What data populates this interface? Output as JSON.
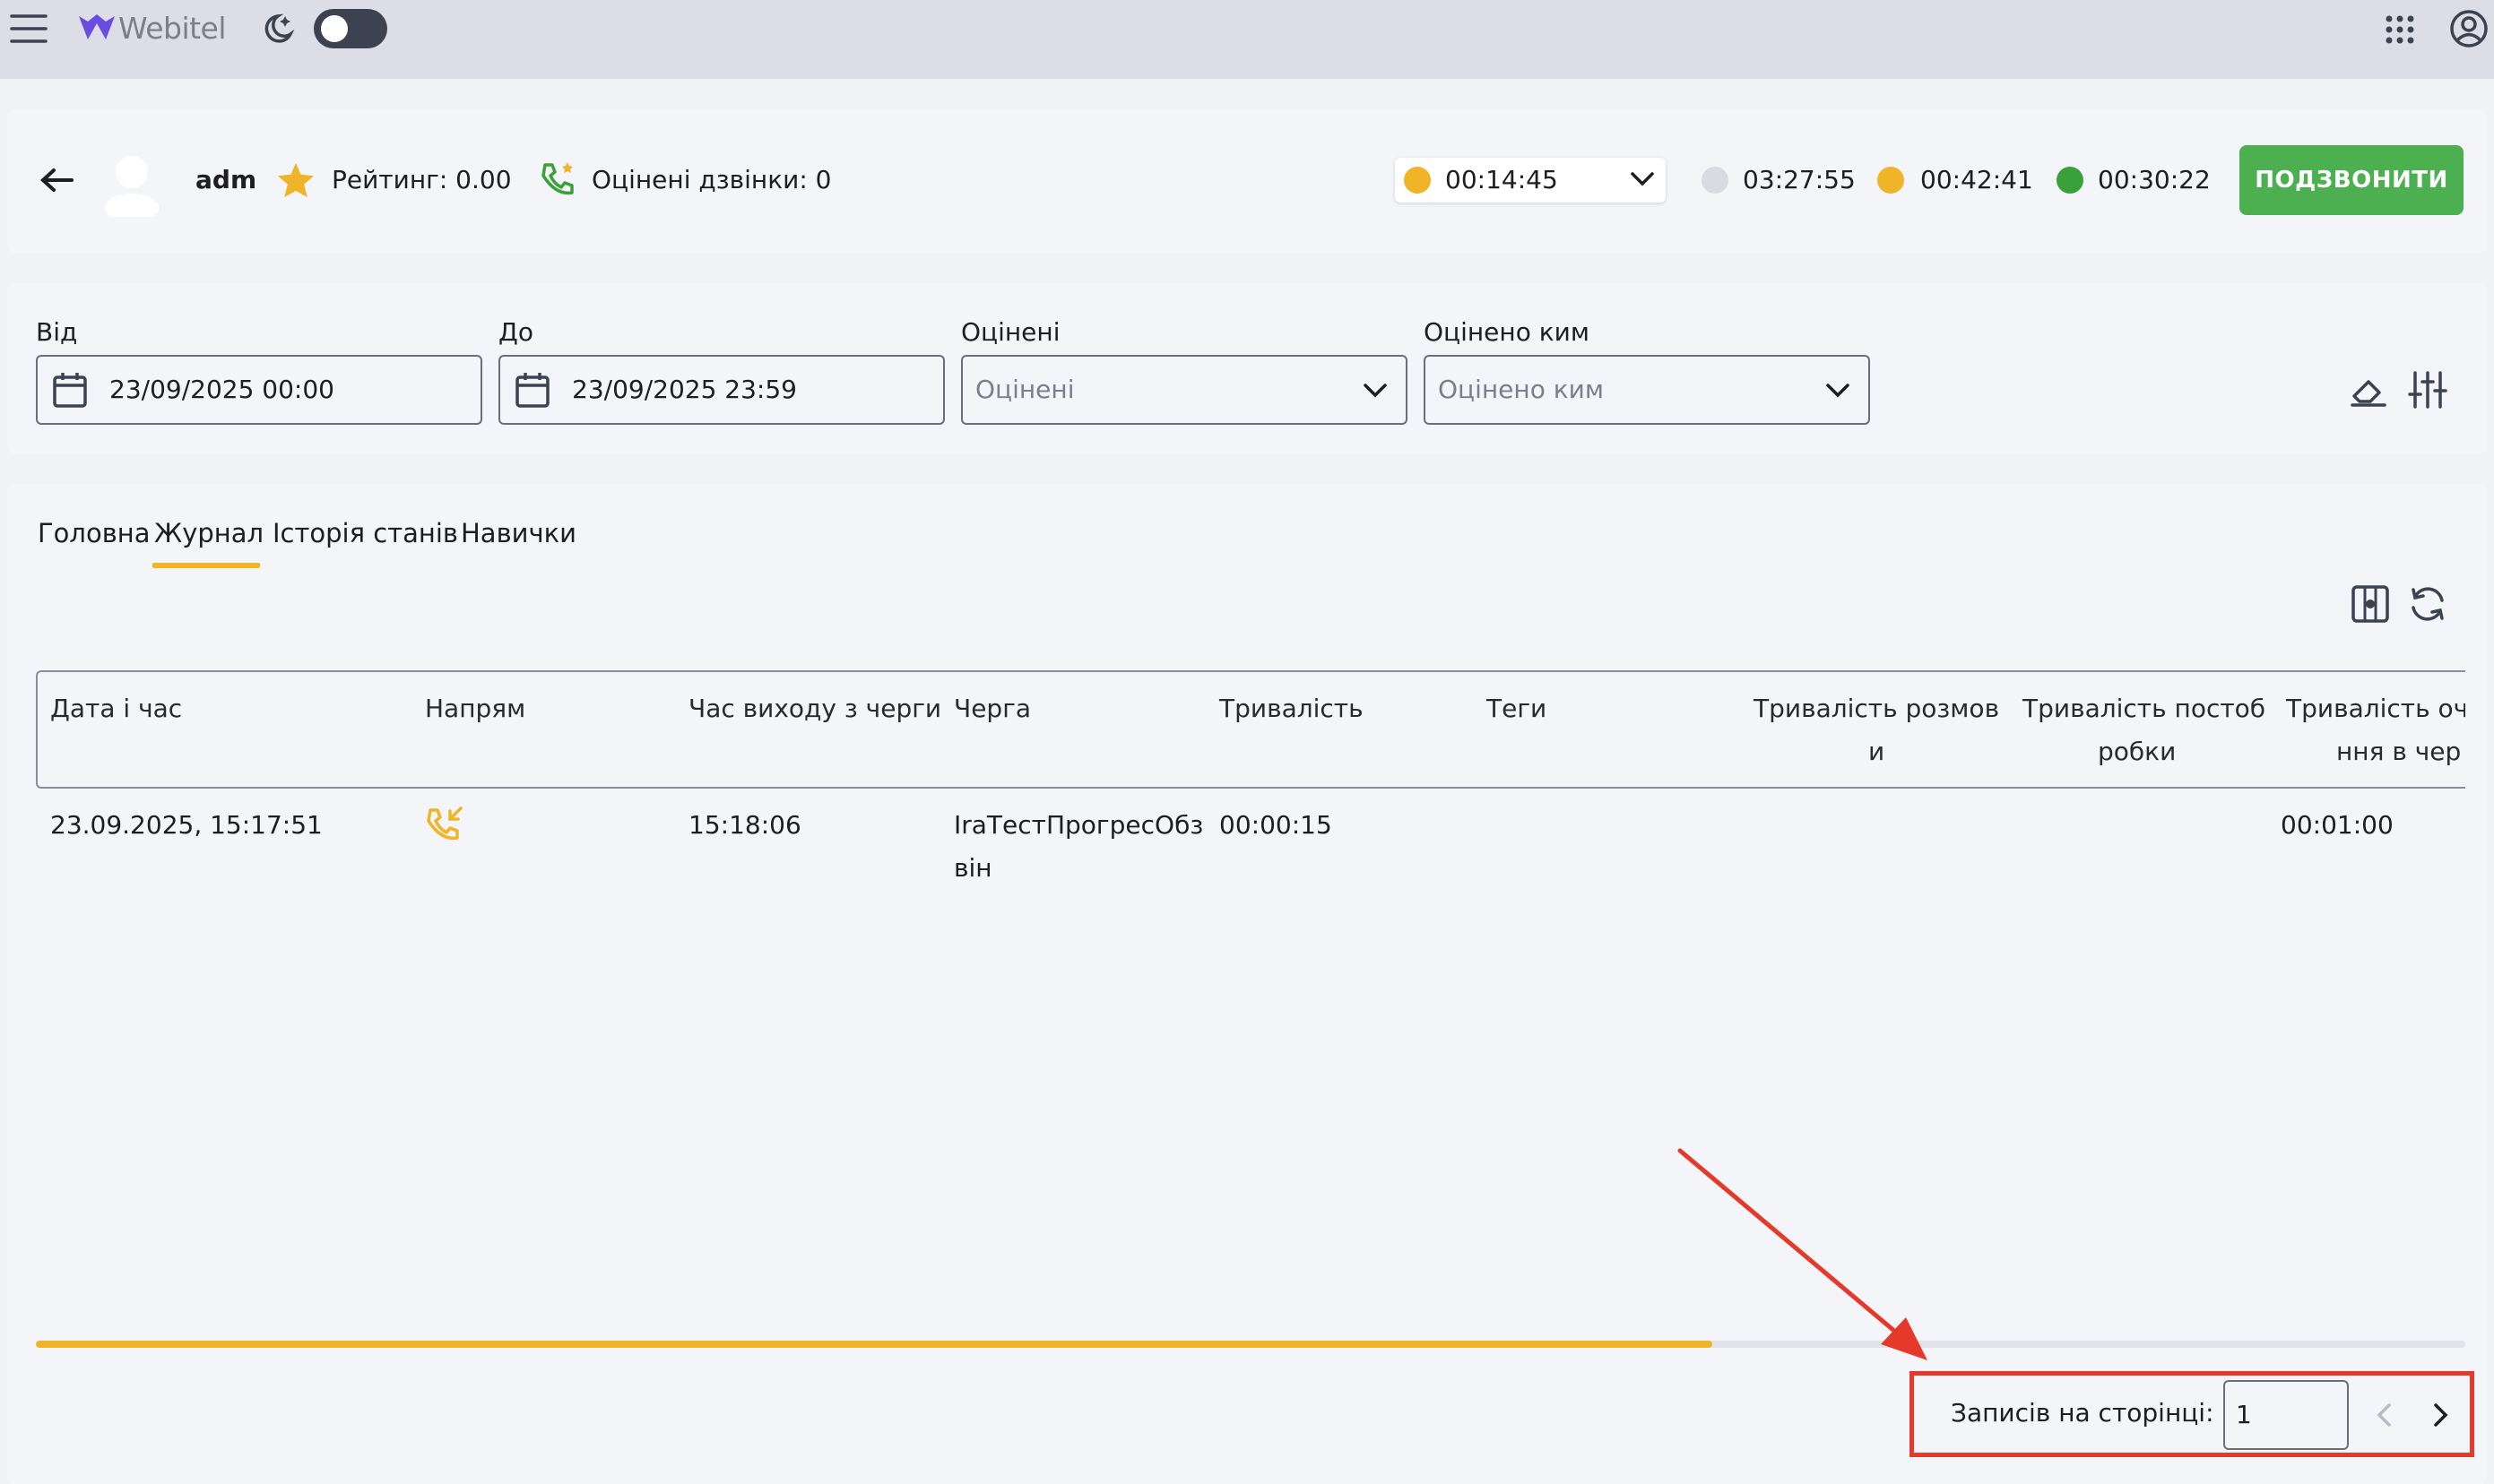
{
  "app": {
    "logo_text": "Webitel",
    "accent_color": "#f0b429",
    "brand_color": "#6a4ce0"
  },
  "header": {
    "back_icon": "arrow-left-icon",
    "agent_name": "adm",
    "rating_label": "Рейтинг: 0.00",
    "rated_calls_label": "Оцінені дзвінки: 0",
    "current_status_time": "00:14:45",
    "status_times": [
      {
        "time": "03:27:55",
        "color": "#d9dbe2"
      },
      {
        "time": "00:42:41",
        "color": "#f0b429"
      },
      {
        "time": "00:30:22",
        "color": "#3aa03a"
      }
    ],
    "call_button": "ПОДЗВОНИТИ"
  },
  "filters": {
    "from_label": "Від",
    "from_value": "23/09/2025 00:00",
    "to_label": "До",
    "to_value": "23/09/2025 23:59",
    "rated_label": "Оцінені",
    "rated_placeholder": "Оцінені",
    "rated_by_label": "Оцінено ким",
    "rated_by_placeholder": "Оцінено ким"
  },
  "tabs": [
    {
      "label": "Головна"
    },
    {
      "label": "Журнал",
      "active": true
    },
    {
      "label": "Історія станів"
    },
    {
      "label": "Навички"
    }
  ],
  "table": {
    "columns": [
      "Дата і час",
      "Напрям",
      "Час виходу з черги",
      "Черга",
      "Тривалість",
      "Теги",
      [
        "Тривалість розмов",
        "и"
      ],
      [
        "Тривалість постоб",
        "робки"
      ],
      [
        "Тривалість оч",
        "ння в чер"
      ]
    ],
    "rows": [
      {
        "datetime": "23.09.2025, 15:17:51",
        "direction_icon": "incoming-call-icon",
        "queue_exit_time": "15:18:06",
        "queue": [
          "IraТестПрогресОбз",
          "він"
        ],
        "duration": "00:00:15",
        "tags": "",
        "talk_duration": "",
        "postprocess_duration": "",
        "queue_wait_duration": "00:01:00"
      }
    ]
  },
  "scroll_progress": 0.69,
  "pagination": {
    "per_page_label": "Записів на сторінці:",
    "per_page_value": "1"
  }
}
